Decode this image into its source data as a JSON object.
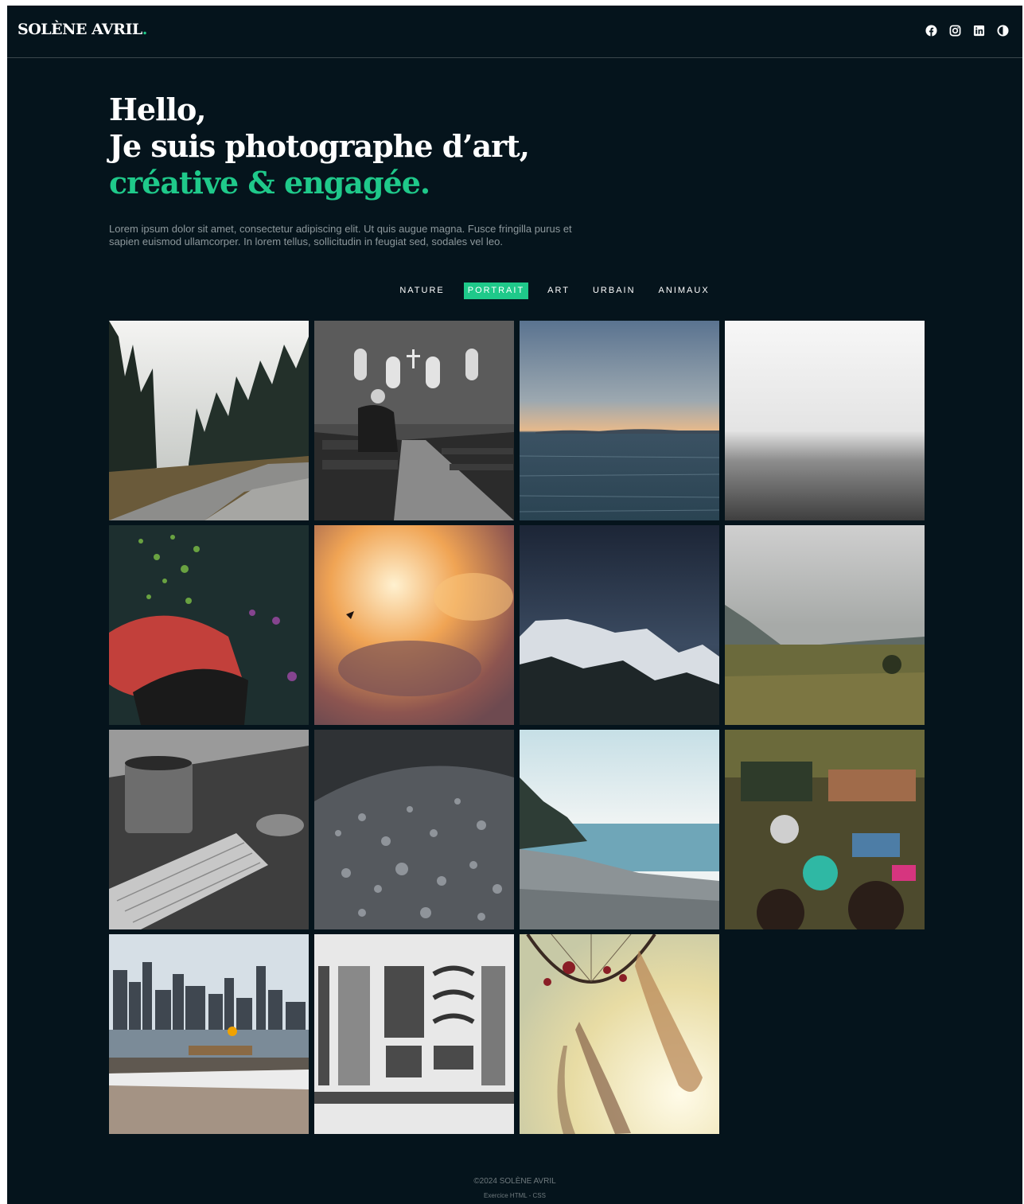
{
  "header": {
    "brand": "SOLÈNE AVRIL",
    "brand_dot": ".",
    "social_icons": [
      "facebook-icon",
      "instagram-icon",
      "linkedin-icon",
      "theme-toggle-icon"
    ]
  },
  "hero": {
    "line1": "Hello,",
    "line2": "Je suis photographe d’art,",
    "line3": "créative & engagée.",
    "lead": "Lorem ipsum dolor sit amet, consectetur adipiscing elit. Ut quis augue magna. Fusce fringilla purus et sapien euismod ullamcorper. In lorem tellus, sollicitudin in feugiat sed, sodales vel leo."
  },
  "filters": [
    {
      "label": "NATURE",
      "active": false
    },
    {
      "label": "PORTRAIT",
      "active": true
    },
    {
      "label": "ART",
      "active": false
    },
    {
      "label": "URBAIN",
      "active": false
    },
    {
      "label": "ANIMAUX",
      "active": false
    }
  ],
  "gallery": {
    "items": [
      "forest-road-photo",
      "church-interior-photo",
      "sea-sunset-photo",
      "foggy-sea-photo",
      "red-umbrella-photo",
      "bird-clouds-photo",
      "mountains-night-photo",
      "valley-field-photo",
      "keyboard-mug-photo",
      "water-drops-photo",
      "beach-shore-photo",
      "floating-market-photo",
      "city-skyline-photo",
      "typewriter-parts-photo",
      "dreamcatcher-photo"
    ]
  },
  "colors": {
    "background": "#05141c",
    "accent": "#1fc98a",
    "text": "#ffffff",
    "muted": "#8d989c"
  },
  "footer": {
    "copyright": "©2024 SOLÈNE AVRIL",
    "subtitle": "Exercice HTML - CSS"
  }
}
